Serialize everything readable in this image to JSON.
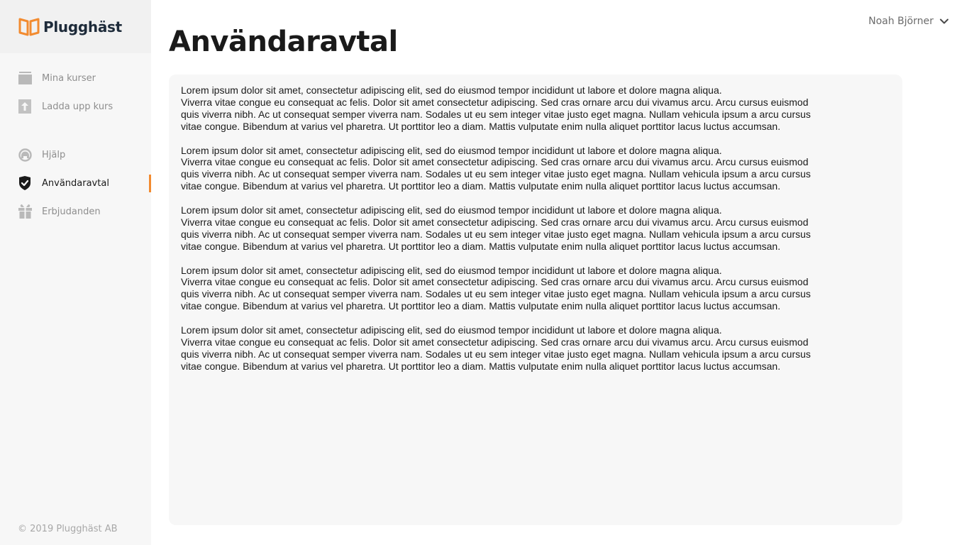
{
  "brand": {
    "name": "Plugghäst",
    "accent": "#f28b30"
  },
  "sidebar": {
    "group1": [
      {
        "label": "Mina kurser",
        "icon": "folder-icon"
      },
      {
        "label": "Ladda upp kurs",
        "icon": "upload-icon"
      }
    ],
    "group2": [
      {
        "label": "Hjälp",
        "icon": "help-icon"
      },
      {
        "label": "Användaravtal",
        "icon": "shield-check-icon",
        "active": true
      },
      {
        "label": "Erbjudanden",
        "icon": "gift-icon"
      }
    ],
    "copyright": "© 2019 Plugghäst AB"
  },
  "user": {
    "name": "Noah Björner"
  },
  "page": {
    "title": "Användaravtal",
    "paragraphs": [
      {
        "first": "Lorem ipsum dolor sit amet, consectetur adipiscing elit, sed do eiusmod tempor incididunt ut labore et dolore magna aliqua.",
        "rest": "Viverra vitae congue eu consequat ac felis. Dolor sit amet consectetur adipiscing. Sed cras ornare arcu dui vivamus arcu. Arcu cursus euismod quis viverra nibh. Ac ut consequat semper viverra nam. Sodales ut eu sem integer vitae justo eget magna. Nullam vehicula ipsum a arcu cursus vitae congue. Bibendum at varius vel pharetra. Ut porttitor leo a diam. Mattis vulputate enim nulla aliquet porttitor lacus luctus accumsan."
      },
      {
        "first": "Lorem ipsum dolor sit amet, consectetur adipiscing elit, sed do eiusmod tempor incididunt ut labore et dolore magna aliqua.",
        "rest": "Viverra vitae congue eu consequat ac felis. Dolor sit amet consectetur adipiscing. Sed cras ornare arcu dui vivamus arcu. Arcu cursus euismod quis viverra nibh. Ac ut consequat semper viverra nam. Sodales ut eu sem integer vitae justo eget magna. Nullam vehicula ipsum a arcu cursus vitae congue. Bibendum at varius vel pharetra. Ut porttitor leo a diam. Mattis vulputate enim nulla aliquet porttitor lacus luctus accumsan."
      },
      {
        "first": "Lorem ipsum dolor sit amet, consectetur adipiscing elit, sed do eiusmod tempor incididunt ut labore et dolore magna aliqua.",
        "rest": "Viverra vitae congue eu consequat ac felis. Dolor sit amet consectetur adipiscing. Sed cras ornare arcu dui vivamus arcu. Arcu cursus euismod quis viverra nibh. Ac ut consequat semper viverra nam. Sodales ut eu sem integer vitae justo eget magna. Nullam vehicula ipsum a arcu cursus vitae congue. Bibendum at varius vel pharetra. Ut porttitor leo a diam. Mattis vulputate enim nulla aliquet porttitor lacus luctus accumsan."
      },
      {
        "first": "Lorem ipsum dolor sit amet, consectetur adipiscing elit, sed do eiusmod tempor incididunt ut labore et dolore magna aliqua.",
        "rest": "Viverra vitae congue eu consequat ac felis. Dolor sit amet consectetur adipiscing. Sed cras ornare arcu dui vivamus arcu. Arcu cursus euismod quis viverra nibh. Ac ut consequat semper viverra nam. Sodales ut eu sem integer vitae justo eget magna. Nullam vehicula ipsum a arcu cursus vitae congue. Bibendum at varius vel pharetra. Ut porttitor leo a diam. Mattis vulputate enim nulla aliquet porttitor lacus luctus accumsan."
      },
      {
        "first": "Lorem ipsum dolor sit amet, consectetur adipiscing elit, sed do eiusmod tempor incididunt ut labore et dolore magna aliqua.",
        "rest": "Viverra vitae congue eu consequat ac felis. Dolor sit amet consectetur adipiscing. Sed cras ornare arcu dui vivamus arcu. Arcu cursus euismod quis viverra nibh. Ac ut consequat semper viverra nam. Sodales ut eu sem integer vitae justo eget magna. Nullam vehicula ipsum a arcu cursus vitae congue. Bibendum at varius vel pharetra. Ut porttitor leo a diam. Mattis vulputate enim nulla aliquet porttitor lacus luctus accumsan."
      }
    ]
  }
}
